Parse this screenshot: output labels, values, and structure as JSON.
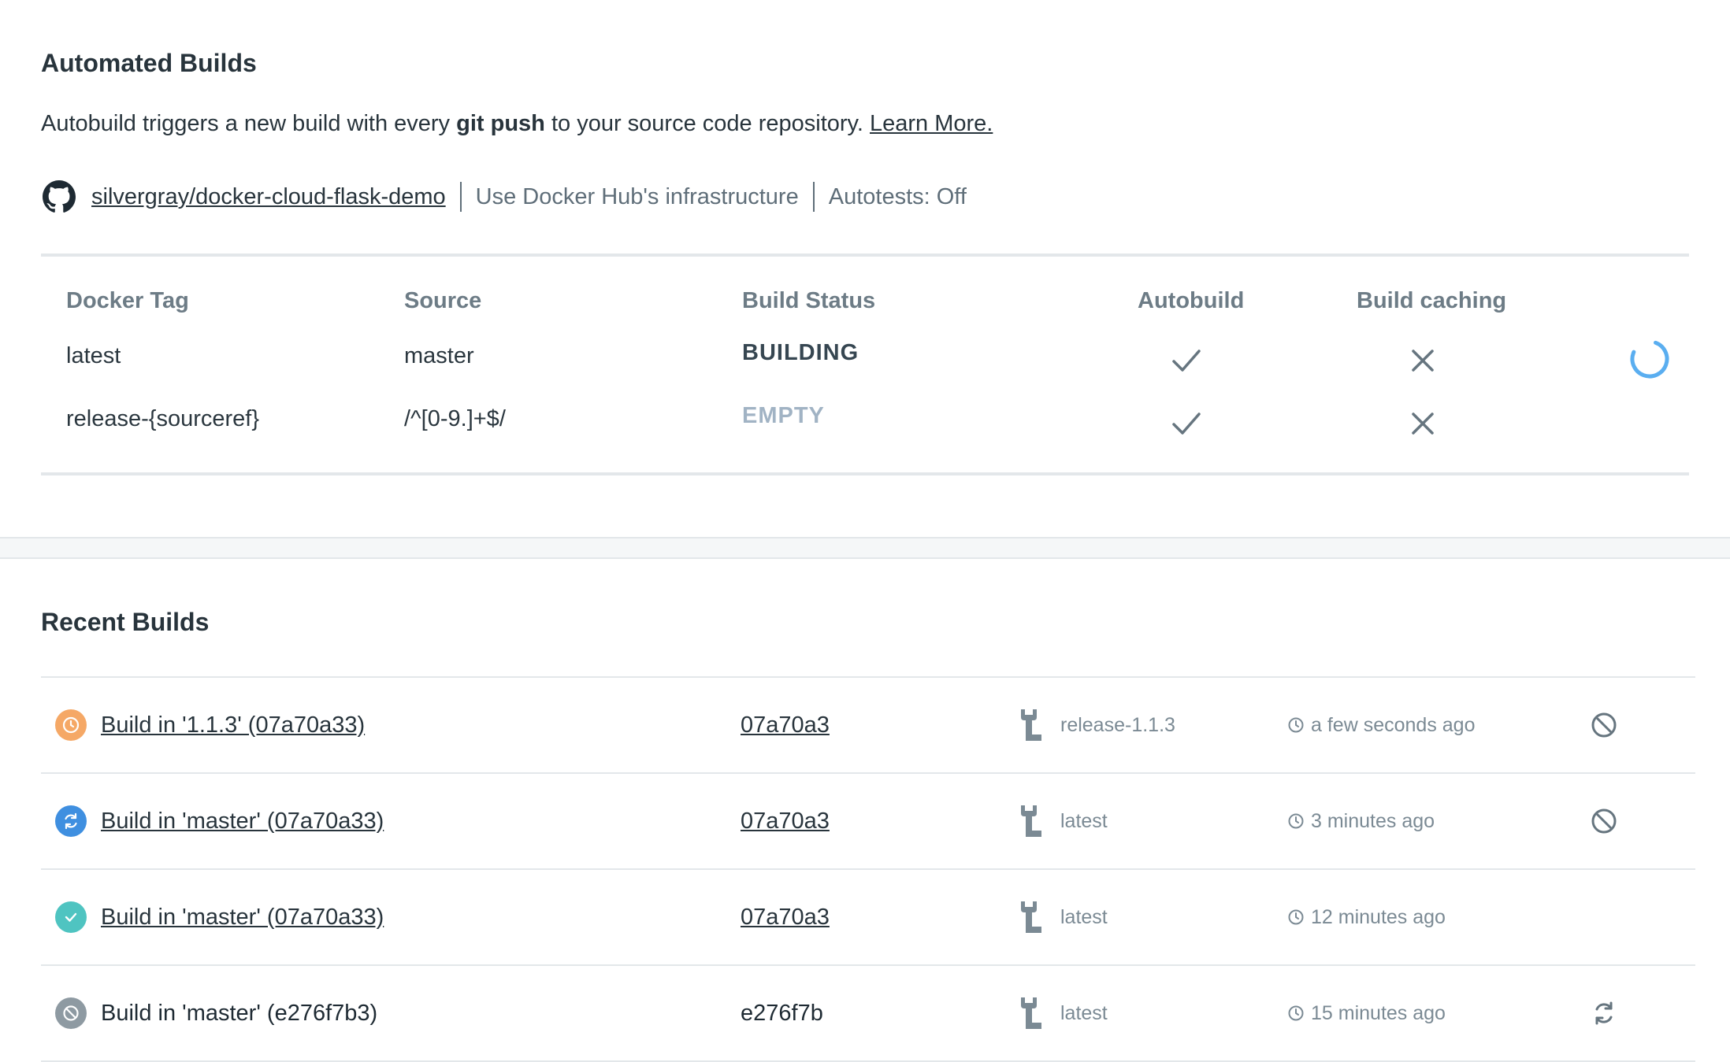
{
  "automated": {
    "title": "Automated Builds",
    "desc_prefix": "Autobuild triggers a new build with every ",
    "desc_bold": "git push",
    "desc_suffix": " to your source code repository. ",
    "learn_more": "Learn More.",
    "repo": "silvergray/docker-cloud-flask-demo",
    "infra": "Use Docker Hub's infrastructure",
    "autotests": "Autotests: Off"
  },
  "rules_table": {
    "headers": [
      "Docker Tag",
      "Source",
      "Build Status",
      "Autobuild",
      "Build caching"
    ],
    "rows": [
      {
        "tag": "latest",
        "source": "master",
        "status": "BUILDING",
        "autobuild": "check-icon",
        "caching": "x-icon",
        "action": "spinner-icon"
      },
      {
        "tag": "release-{sourceref}",
        "source": "/^[0-9.]+$/",
        "status": "EMPTY",
        "autobuild": "check-icon",
        "caching": "x-icon",
        "action": ""
      }
    ]
  },
  "recent": {
    "title": "Recent Builds",
    "builds": [
      {
        "name": "Build in '1.1.3' (07a70a33)",
        "commit": "07a70a3",
        "tag": "release-1.1.3",
        "time": "a few seconds ago",
        "status_icon": "clock-icon",
        "status_color": "#f5a866",
        "action_icon": "cancel-icon"
      },
      {
        "name": "Build in 'master' (07a70a33)",
        "commit": "07a70a3",
        "tag": "latest",
        "time": "3 minutes ago",
        "status_icon": "refresh-icon",
        "status_color": "#3f8fe0",
        "action_icon": "cancel-icon"
      },
      {
        "name": "Build in 'master' (07a70a33)",
        "commit": "07a70a3",
        "tag": "latest",
        "time": "12 minutes ago",
        "status_icon": "check-icon",
        "status_color": "#4fc4c1",
        "action_icon": ""
      },
      {
        "name": "Build in 'master' (e276f7b3)",
        "commit": "e276f7b",
        "tag": "latest",
        "time": "15 minutes ago",
        "status_icon": "cancel-icon",
        "status_color": "#8e9aa2",
        "action_icon": "retry-icon"
      }
    ]
  }
}
